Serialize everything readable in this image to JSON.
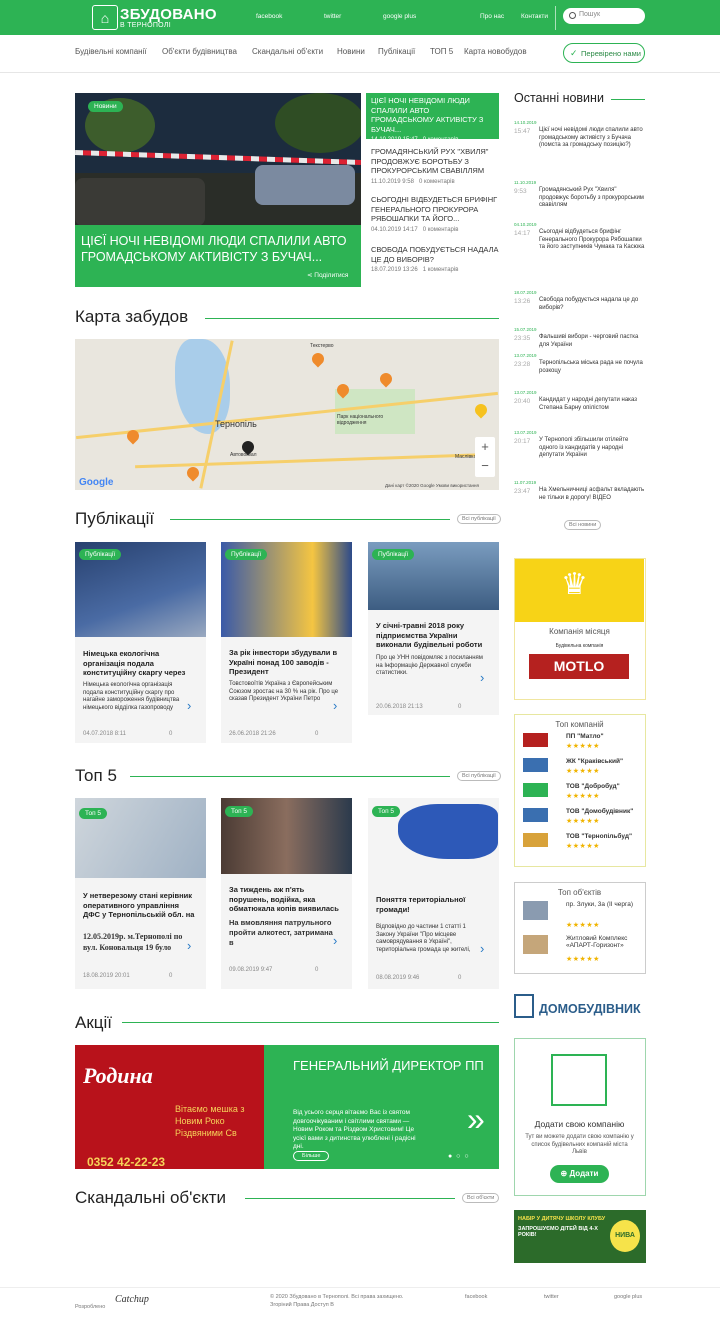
{
  "header": {
    "brand_line1": "ЗБУДОВАНО",
    "brand_line2": "В ТЕРНОПОЛІ",
    "social": [
      "facebook",
      "twitter",
      "google plus"
    ],
    "nav": [
      "Про нас",
      "Контакти"
    ],
    "search_placeholder": "Пошук"
  },
  "menu": {
    "items": [
      "Будівельні компанії",
      "Об'єкти будівництва",
      "Скандальні об'єкти",
      "Новини",
      "Публікації",
      "ТОП 5",
      "Карта новобудов"
    ],
    "verified": "Перевірено нами"
  },
  "hero": {
    "badge": "Новини",
    "title": "ЦІЄЇ НОЧІ НЕВІДОМІ ЛЮДИ СПАЛИЛИ АВТО ГРОМАДСЬКОМУ АКТИВІСТУ З БУЧАЧ...",
    "share": "Поділитися"
  },
  "side_news": [
    {
      "title": "ЦІЄЇ НОЧІ НЕВІДОМІ ЛЮДИ СПАЛИЛИ АВТО ГРОМАДСЬКОМУ АКТИВІСТУ З БУЧАЧ...",
      "date": "14.10.2019 15:47",
      "comments": "0 коментарів"
    },
    {
      "title": "ГРОМАДЯНСЬКИЙ РУХ \"ХВИЛЯ\" ПРОДОВЖУЄ БОРОТЬБУ З ПРОКУРОРСЬКИМ СВАВІЛЛЯМ",
      "date": "11.10.2019 9:58",
      "comments": "0 коментарів"
    },
    {
      "title": "СЬОГОДНІ ВІДБУДЕТЬСЯ БРИФІНГ ГЕНЕРАЛЬНОГО ПРОКУРОРА РЯБОШАПКИ ТА ЙОГО...",
      "date": "04.10.2019 14:17",
      "comments": "0 коментарів"
    },
    {
      "title": "СВОБОДА ПОБУДУЄТЬСЯ НАДАЛА ЦЕ ДО ВИБОРІВ?",
      "date": "18.07.2019 13:26",
      "comments": "1 коментарів"
    }
  ],
  "sections": {
    "map": "Карта забудов",
    "publications": "Публікації",
    "top5": "Топ 5",
    "promos": "Акції",
    "scandal": "Скандальні об'єкти",
    "all": "Всі публікації",
    "all_top": "Всі публікації",
    "all_scandal": "Всі об'єкти"
  },
  "map": {
    "city": "Тернопіль",
    "labels": [
      "Текстерво",
      "Парк національного відродження",
      "Автовокзал",
      "Маслівка"
    ],
    "credit": "Дані карт ©2020 Google   Умови використання",
    "logo": "Google"
  },
  "publications": [
    {
      "badge": "Публікації",
      "title": "Німецька екологічна організація подала конституційну скаргу через",
      "desc": "Німецька екологічна організація подала конституційну скаргу про нагайне замороження будівництва німецького відділка газопроводу",
      "date": "04.07.2018 8:11",
      "comments": "0"
    },
    {
      "badge": "Публікації",
      "title": "За рік інвестори збудували в Україні понад 100 заводів - Президент",
      "desc": "Товстовоїтів Україна з Європейським Союзом зростає на 30 % на рік. Про це сказав Президент України Петро",
      "date": "26.06.2018 21:26",
      "comments": "0"
    },
    {
      "badge": "Публікації",
      "title": "У січні-травні 2018 року підприємства України виконали будівельні роботи",
      "desc": "Про це УНН повідомляє з посиланням на Інформацію Державної служби статистики.",
      "date": "20.06.2018 21:13",
      "comments": "0"
    }
  ],
  "top5": [
    {
      "badge": "Топ 5",
      "title": "У нетверезому стані керівник оперативного управління ДФС у Тернопільській обл. на",
      "desc": "12.05.2019р. м.Тернополі по вул. Коновальця 19 було",
      "date": "18.08.2019 20:01",
      "comments": "0"
    },
    {
      "badge": "Топ 5",
      "title": "За тиждень аж п'ять порушень, водійка, яка обматюкала копів виявилась",
      "desc": "На вмовляння патрульного пройти алкотест, затримана в",
      "date": "09.08.2019 9:47",
      "comments": "0"
    },
    {
      "badge": "Топ 5",
      "title": "Поняття територіальної громади!",
      "desc": "Відповідно до частини 1 статті 1 Закону України \"Про місцеве самоврядування в Україні\", територіальна громада це жителі,",
      "date": "08.08.2019 9:46",
      "comments": "0"
    }
  ],
  "promo": {
    "headline": "ГЕНЕРАЛЬНИЙ ДИРЕКТОР ПП",
    "text": "Від усього серця вітаємо Вас із святом довгоочікуваним і світлими святами — Новим Роком та Різдвом Христовим! Це усієї вами з дитинства улюблені і радісні дні.",
    "button": "Більше",
    "banner_brand": "Родина",
    "banner_text": "Вітаємо мешка з Новим Роко Різдвяними Св",
    "banner_phone": "0352 42-22-23"
  },
  "latest": {
    "title": "Останні новини",
    "all": "Всі новини",
    "items": [
      {
        "date": "14.10.2019",
        "time": "15:47",
        "text": "Цієї ночі невідомі люди спалили авто громадському активісту з Бучача (помста за громадську позицію?)"
      },
      {
        "date": "11.10.2019",
        "time": "9:53",
        "text": "Громадянський Рух \"Хвиля\" продовжує боротьбу з прокурорським свавіллям"
      },
      {
        "date": "04.10.2019",
        "time": "14:17",
        "text": "Сьогодні відбудеться брифінг Генерального Прокурора Рябошапки та його заступників Чумака та Касюка"
      },
      {
        "date": "18.07.2019",
        "time": "13:26",
        "text": "Свобода побудується надала це до виборів?"
      },
      {
        "date": "15.07.2019",
        "time": "23:35",
        "text": "Фальшиві вибори - черговий пастка для України"
      },
      {
        "date": "13.07.2019",
        "time": "23:28",
        "text": "Тернопільська міська рада не почула розкоцу"
      },
      {
        "date": "13.07.2019",
        "time": "20:40",
        "text": "Кандидат у народні депутати наказ Степана Барну опілістом"
      },
      {
        "date": "13.07.2019",
        "time": "20:17",
        "text": "У Тернополі збільшили отілейте одного із кандидатів у народні депутати України"
      },
      {
        "date": "11.07.2019",
        "time": "23:47",
        "text": "На Хмельничниці асфальт вкладають не тільки в дорогу! ВІДЕО"
      }
    ]
  },
  "company_month": {
    "title": "Компанія місяця",
    "brand": "MOTLO",
    "tagline": "Будівельна компанія"
  },
  "top_companies": {
    "title": "Топ компаній",
    "items": [
      "ПП \"Матло\"",
      "ЖК \"Краківський\"",
      "ТОВ \"Добробуд\"",
      "ТОВ \"Домобудівник\"",
      "ТОВ \"Тернопільбуд\""
    ],
    "stars": [
      "★★★★★",
      "★★★★★",
      "★★★★★",
      "★★★★★",
      "★★★★★"
    ]
  },
  "top_objects": {
    "title": "Топ об'єктів",
    "items": [
      "пр. Злуки, 3а (II черга)",
      "Житловий Комплекс «АПАРТ-Горизонт»"
    ],
    "stars": [
      "★★★★★",
      "★★★★★"
    ]
  },
  "domobud": {
    "text": "ДОМОБУДІВНИК"
  },
  "add_company": {
    "title": "Додати свою компанію",
    "text": "Тут ви можете додати свою компанію у список будівельних компаній міста Львів",
    "button": "Додати"
  },
  "niva_banner": {
    "text1": "НАБІР У ДИТЯЧУ ШКОЛУ КЛУБУ",
    "text2": "ЗАПРОШУЄМО ДІТЕЙ ВІД 4-Х РОКІВ!",
    "brand": "НИВА"
  },
  "footer": {
    "developer": "Розроблено",
    "dev_brand": "Catchup",
    "copy": "© 2020 Збудовано в Тернополі. Всі права захищено.",
    "links": [
      "facebook",
      "twitter",
      "google plus"
    ],
    "policy": "Згоріний   Права   Доступ   В"
  }
}
